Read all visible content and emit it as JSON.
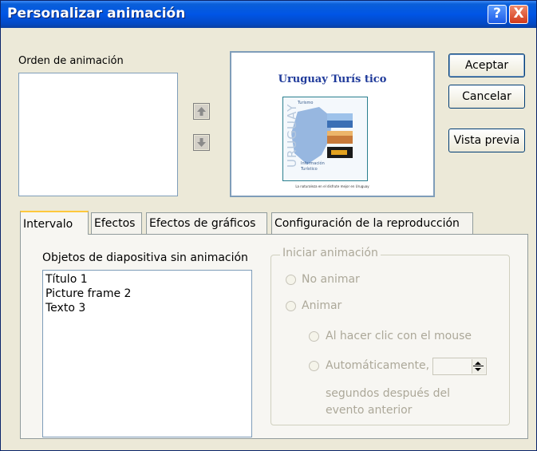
{
  "window": {
    "title": "Personalizar animación"
  },
  "titlebar": {
    "help_glyph": "?",
    "close_glyph": "X"
  },
  "order": {
    "label": "Orden de animación",
    "items": []
  },
  "buttons": {
    "accept": "Aceptar",
    "cancel": "Cancelar",
    "preview": "Vista previa"
  },
  "slide_preview": {
    "title": "Uruguay Turís tico",
    "thumb_side_text": "URUGUAY",
    "thumb_top_text": "Turismo",
    "thumb_caption_1": "Información",
    "thumb_caption_2": "Turístico",
    "footer": "La naturaleza en el disfrute mejor en Uruguay"
  },
  "tabs": [
    {
      "label": "Intervalo",
      "active": true
    },
    {
      "label": "Efectos",
      "active": false
    },
    {
      "label": "Efectos de gráficos",
      "active": false
    },
    {
      "label": "Configuración de la reproducción",
      "active": false
    }
  ],
  "objects": {
    "label": "Objetos de diapositiva sin animación",
    "items": [
      "Título 1",
      "Picture frame 2",
      "Texto 3"
    ]
  },
  "start_animation": {
    "legend": "Iniciar animación",
    "no_animate": "No animar",
    "animate": "Animar",
    "on_click": "Al hacer clic con el mouse",
    "automatic": "Automáticamente,",
    "seconds_after_1": "segundos después del",
    "seconds_after_2": "evento anterior",
    "seconds_value": ""
  },
  "colors": {
    "title_bar": "#0055e5",
    "close": "#d2391a",
    "panel": "#ece9d8"
  }
}
